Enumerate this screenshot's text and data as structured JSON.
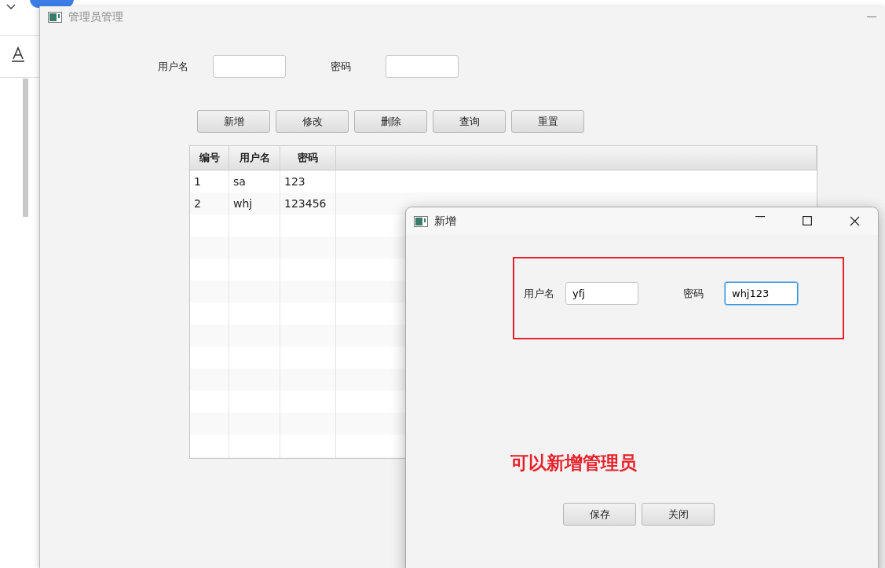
{
  "main_window": {
    "title": "管理员管理",
    "search": {
      "fields": [
        {
          "label": "用户名"
        },
        {
          "label": "密码"
        }
      ]
    },
    "buttons": [
      "新增",
      "修改",
      "删除",
      "查询",
      "重置"
    ],
    "table": {
      "columns": [
        "编号",
        "用户名",
        "密码"
      ],
      "rows": [
        [
          "1",
          "sa",
          "123"
        ],
        [
          "2",
          "whj",
          "123456"
        ]
      ]
    }
  },
  "dialog": {
    "title": "新增",
    "fields": [
      {
        "label": "用户名",
        "value": "yfj",
        "focused": false
      },
      {
        "label": "密码",
        "value": "whj123",
        "focused": true
      }
    ],
    "annotation": "可以新增管理员",
    "buttons": [
      "保存",
      "关闭"
    ]
  }
}
